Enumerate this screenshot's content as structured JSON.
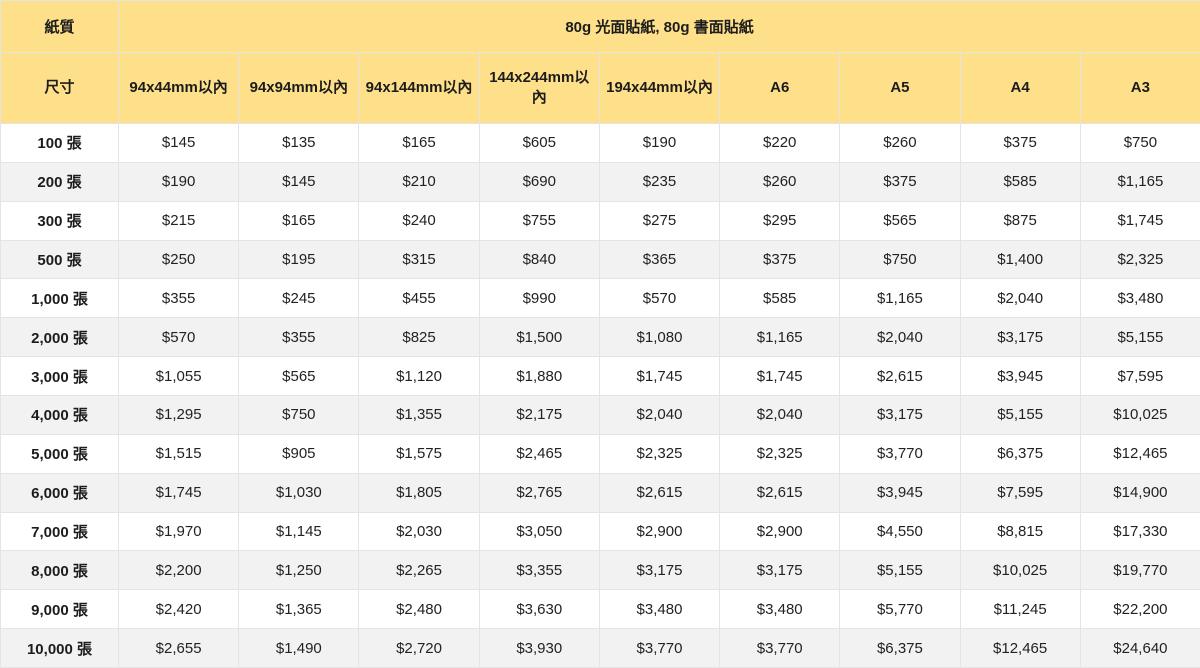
{
  "table": {
    "paper_label": "紙質",
    "paper_value": "80g 光面貼紙, 80g 書面貼紙",
    "size_label": "尺寸",
    "sizes": [
      "94x44mm以內",
      "94x94mm以內",
      "94x144mm以內",
      "144x244mm以內",
      "194x44mm以內",
      "A6",
      "A5",
      "A4",
      "A3"
    ],
    "rows": [
      {
        "qty": "100 張",
        "prices": [
          "$145",
          "$135",
          "$165",
          "$605",
          "$190",
          "$220",
          "$260",
          "$375",
          "$750"
        ]
      },
      {
        "qty": "200 張",
        "prices": [
          "$190",
          "$145",
          "$210",
          "$690",
          "$235",
          "$260",
          "$375",
          "$585",
          "$1,165"
        ]
      },
      {
        "qty": "300 張",
        "prices": [
          "$215",
          "$165",
          "$240",
          "$755",
          "$275",
          "$295",
          "$565",
          "$875",
          "$1,745"
        ]
      },
      {
        "qty": "500 張",
        "prices": [
          "$250",
          "$195",
          "$315",
          "$840",
          "$365",
          "$375",
          "$750",
          "$1,400",
          "$2,325"
        ]
      },
      {
        "qty": "1,000 張",
        "prices": [
          "$355",
          "$245",
          "$455",
          "$990",
          "$570",
          "$585",
          "$1,165",
          "$2,040",
          "$3,480"
        ]
      },
      {
        "qty": "2,000 張",
        "prices": [
          "$570",
          "$355",
          "$825",
          "$1,500",
          "$1,080",
          "$1,165",
          "$2,040",
          "$3,175",
          "$5,155"
        ]
      },
      {
        "qty": "3,000 張",
        "prices": [
          "$1,055",
          "$565",
          "$1,120",
          "$1,880",
          "$1,745",
          "$1,745",
          "$2,615",
          "$3,945",
          "$7,595"
        ]
      },
      {
        "qty": "4,000 張",
        "prices": [
          "$1,295",
          "$750",
          "$1,355",
          "$2,175",
          "$2,040",
          "$2,040",
          "$3,175",
          "$5,155",
          "$10,025"
        ]
      },
      {
        "qty": "5,000 張",
        "prices": [
          "$1,515",
          "$905",
          "$1,575",
          "$2,465",
          "$2,325",
          "$2,325",
          "$3,770",
          "$6,375",
          "$12,465"
        ]
      },
      {
        "qty": "6,000 張",
        "prices": [
          "$1,745",
          "$1,030",
          "$1,805",
          "$2,765",
          "$2,615",
          "$2,615",
          "$3,945",
          "$7,595",
          "$14,900"
        ]
      },
      {
        "qty": "7,000 張",
        "prices": [
          "$1,970",
          "$1,145",
          "$2,030",
          "$3,050",
          "$2,900",
          "$2,900",
          "$4,550",
          "$8,815",
          "$17,330"
        ]
      },
      {
        "qty": "8,000 張",
        "prices": [
          "$2,200",
          "$1,250",
          "$2,265",
          "$3,355",
          "$3,175",
          "$3,175",
          "$5,155",
          "$10,025",
          "$19,770"
        ]
      },
      {
        "qty": "9,000 張",
        "prices": [
          "$2,420",
          "$1,365",
          "$2,480",
          "$3,630",
          "$3,480",
          "$3,480",
          "$5,770",
          "$11,245",
          "$22,200"
        ]
      },
      {
        "qty": "10,000 張",
        "prices": [
          "$2,655",
          "$1,490",
          "$2,720",
          "$3,930",
          "$3,770",
          "$3,770",
          "$6,375",
          "$12,465",
          "$24,640"
        ]
      }
    ]
  },
  "colors": {
    "header_bg": "#ffe08a",
    "stripe_bg": "#f2f2f2",
    "border": "#e4e4e4"
  }
}
